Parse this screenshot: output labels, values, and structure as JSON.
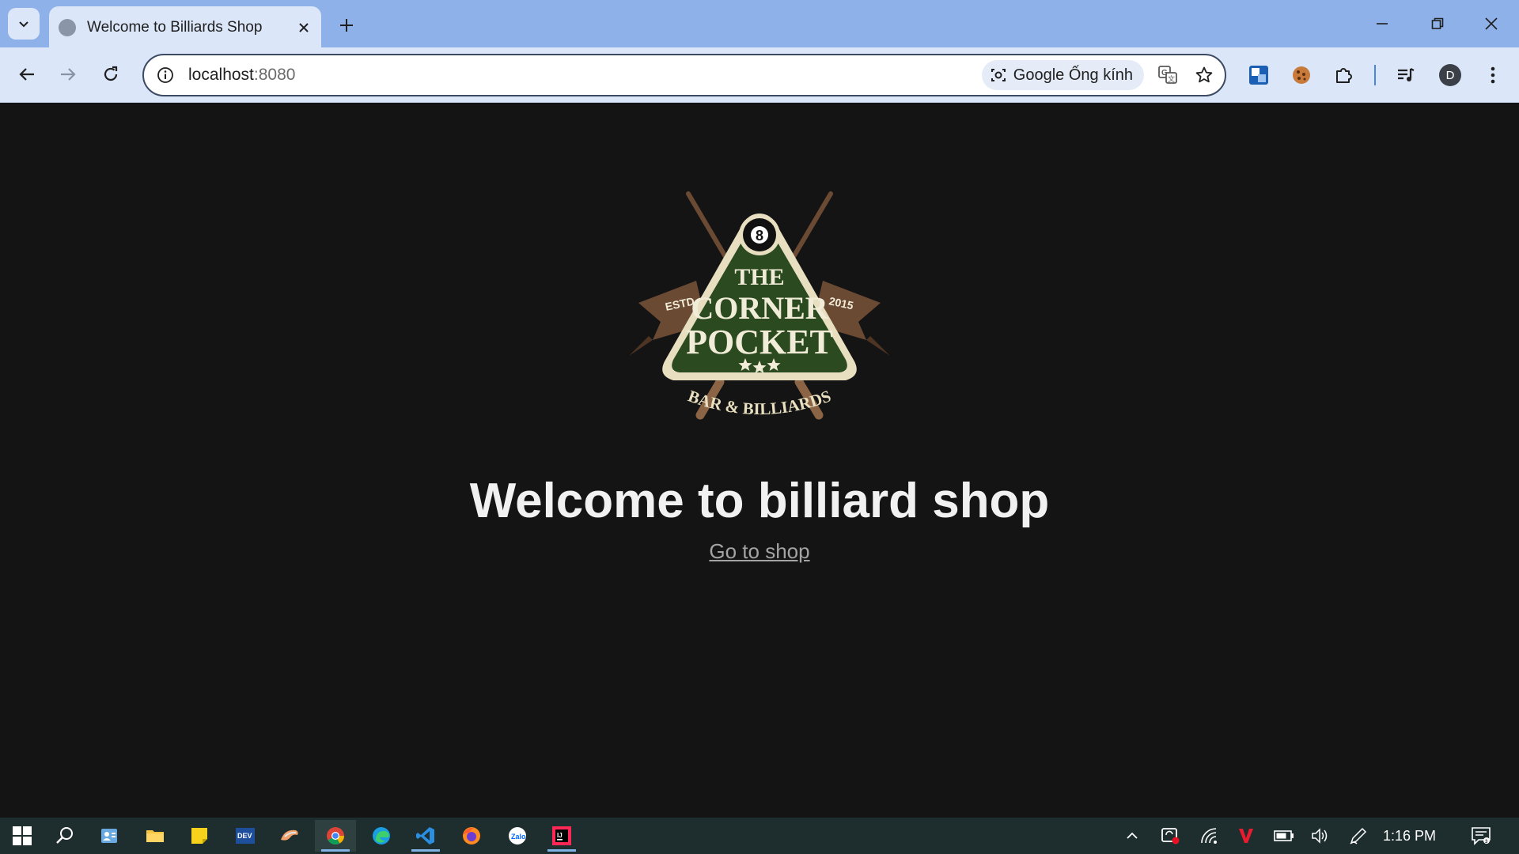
{
  "browser": {
    "tab_title": "Welcome to Billiards Shop",
    "url_host": "localhost",
    "url_port": ":8080",
    "lens_label": "Google Ống kính",
    "profile_initial": "D"
  },
  "page": {
    "logo": {
      "line1": "THE",
      "line2": "CORNER",
      "line3": "POCKET",
      "ball_number": "8",
      "left_banner": "ESTD",
      "right_banner": "2015",
      "bottom_text": "BAR & BILLIARDS"
    },
    "heading": "Welcome to billiard shop",
    "link": "Go to shop"
  },
  "taskbar": {
    "time": "1:16 PM"
  },
  "colors": {
    "chrome_tabstrip": "#8eb1e9",
    "chrome_toolbar": "#dbe6f8",
    "page_bg": "#141414",
    "logo_green": "#2c4a1f",
    "logo_cream": "#e8dfc0",
    "logo_brown": "#6b4a33",
    "taskbar_bg": "#1e2d2e"
  }
}
